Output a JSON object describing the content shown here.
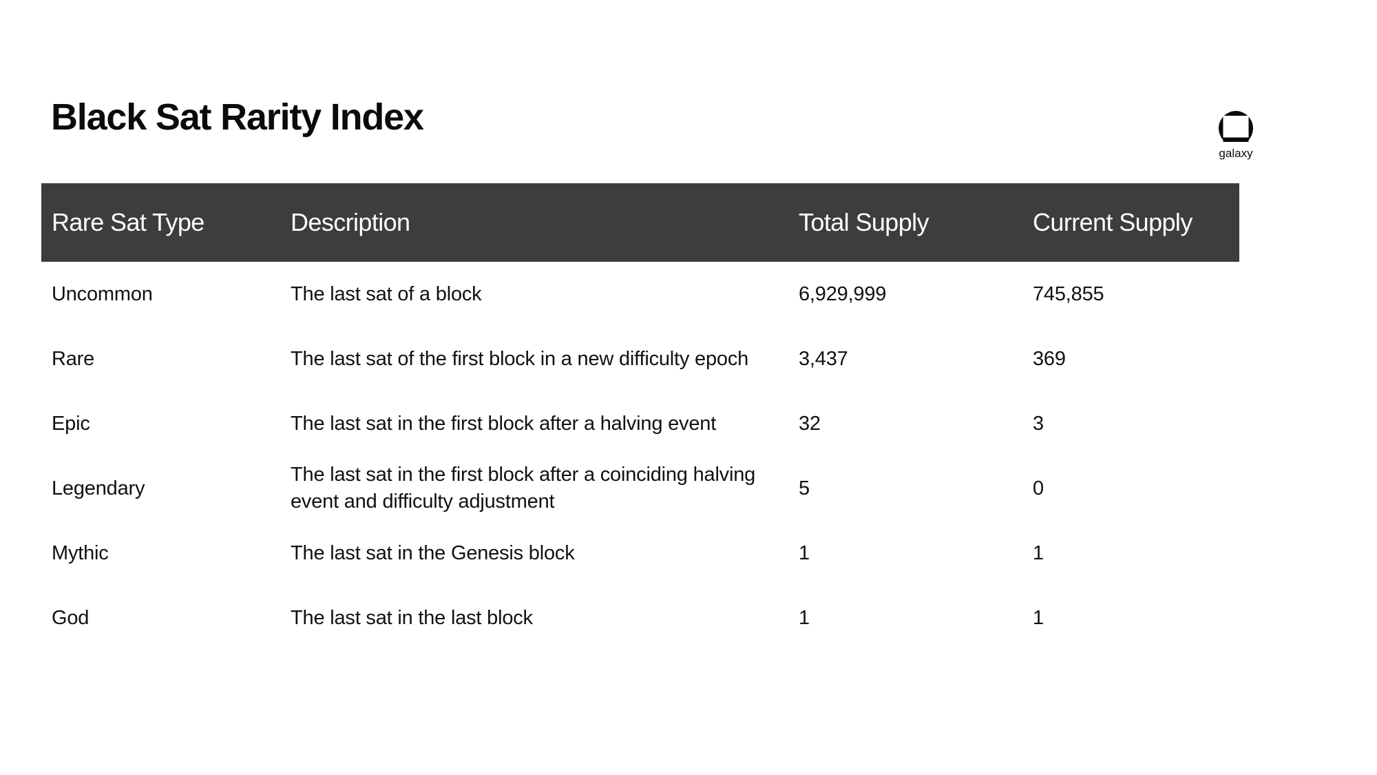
{
  "header": {
    "title": "Black Sat Rarity Index",
    "brand": {
      "wordmark": "galaxy",
      "mark_icon": "galaxy-circle-square-logo"
    }
  },
  "theme": {
    "page_background": "#ffffff",
    "header_row_background": "#3d3d3d",
    "header_row_text": "#ffffff",
    "body_text": "#111111"
  },
  "table": {
    "columns": [
      {
        "key": "type",
        "label": "Rare Sat Type"
      },
      {
        "key": "desc",
        "label": "Description"
      },
      {
        "key": "total",
        "label": "Total Supply"
      },
      {
        "key": "current",
        "label": "Current Supply"
      }
    ],
    "rows": [
      {
        "type": "Uncommon",
        "desc": "The last sat of a block",
        "total": "6,929,999",
        "current": "745,855"
      },
      {
        "type": "Rare",
        "desc": "The last sat of the first block in a new difficulty epoch",
        "total": "3,437",
        "current": "369"
      },
      {
        "type": "Epic",
        "desc": "The last sat in the first block after a halving event",
        "total": "32",
        "current": "3"
      },
      {
        "type": "Legendary",
        "desc": "The last sat in the first block after a coinciding halving event and difficulty adjustment",
        "total": "5",
        "current": "0"
      },
      {
        "type": "Mythic",
        "desc": "The last sat in the Genesis block",
        "total": "1",
        "current": "1"
      },
      {
        "type": "God",
        "desc": "The last sat in the last block",
        "total": "1",
        "current": "1"
      }
    ]
  },
  "chart_data": {
    "type": "table",
    "title": "Black Sat Rarity Index",
    "columns": [
      "Rare Sat Type",
      "Description",
      "Total Supply",
      "Current Supply"
    ],
    "rows": [
      [
        "Uncommon",
        "The last sat of a block",
        6929999,
        745855
      ],
      [
        "Rare",
        "The last sat of the first block in a new difficulty epoch",
        3437,
        369
      ],
      [
        "Epic",
        "The last sat in the first block after a halving event",
        32,
        3
      ],
      [
        "Legendary",
        "The last sat in the first block after a coinciding halving event and difficulty adjustment",
        5,
        0
      ],
      [
        "Mythic",
        "The last sat in the Genesis block",
        1,
        1
      ],
      [
        "God",
        "The last sat in the last block",
        1,
        1
      ]
    ]
  }
}
